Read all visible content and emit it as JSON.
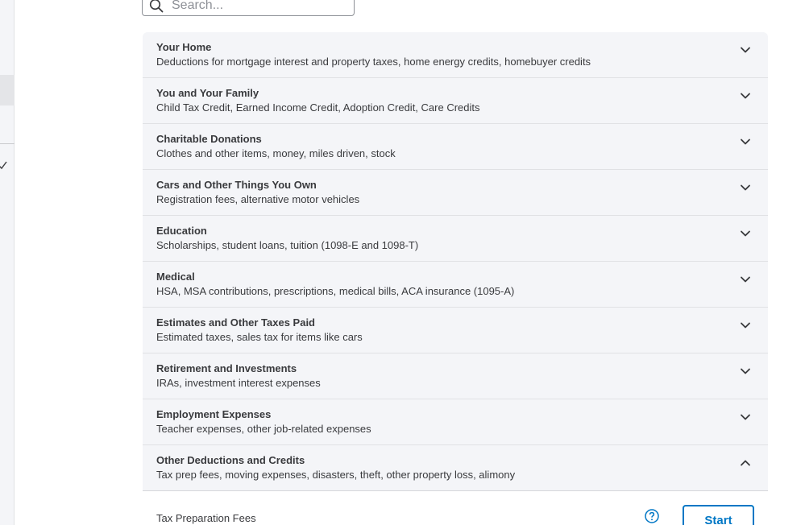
{
  "search": {
    "placeholder": "Search...",
    "icon": "search-icon"
  },
  "sidebar": {
    "icons": [
      "check-icon"
    ]
  },
  "categories": [
    {
      "title": "Your Home",
      "description": "Deductions for mortgage interest and property taxes, home energy credits, homebuyer credits",
      "expanded": false
    },
    {
      "title": "You and Your Family",
      "description": "Child Tax Credit, Earned Income Credit, Adoption Credit, Care Credits",
      "expanded": false
    },
    {
      "title": "Charitable Donations",
      "description": "Clothes and other items, money, miles driven, stock",
      "expanded": false
    },
    {
      "title": "Cars and Other Things You Own",
      "description": "Registration fees, alternative motor vehicles",
      "expanded": false
    },
    {
      "title": "Education",
      "description": "Scholarships, student loans, tuition (1098-E and 1098-T)",
      "expanded": false
    },
    {
      "title": "Medical",
      "description": "HSA, MSA contributions, prescriptions, medical bills, ACA insurance (1095-A)",
      "expanded": false
    },
    {
      "title": "Estimates and Other Taxes Paid",
      "description": "Estimated taxes, sales tax for items like cars",
      "expanded": false
    },
    {
      "title": "Retirement and Investments",
      "description": "IRAs, investment interest expenses",
      "expanded": false
    },
    {
      "title": "Employment Expenses",
      "description": "Teacher expenses, other job-related expenses",
      "expanded": false
    },
    {
      "title": "Other Deductions and Credits",
      "description": "Tax prep fees, moving expenses, disasters, theft, other property loss, alimony",
      "expanded": true
    }
  ],
  "expanded_section": {
    "item_label": "Tax Preparation Fees",
    "start_label": "Start",
    "help_icon": "help-circle-icon"
  },
  "colors": {
    "accent": "#0077c5",
    "row_background": "#f4f5f8",
    "text": "#393a3d"
  }
}
